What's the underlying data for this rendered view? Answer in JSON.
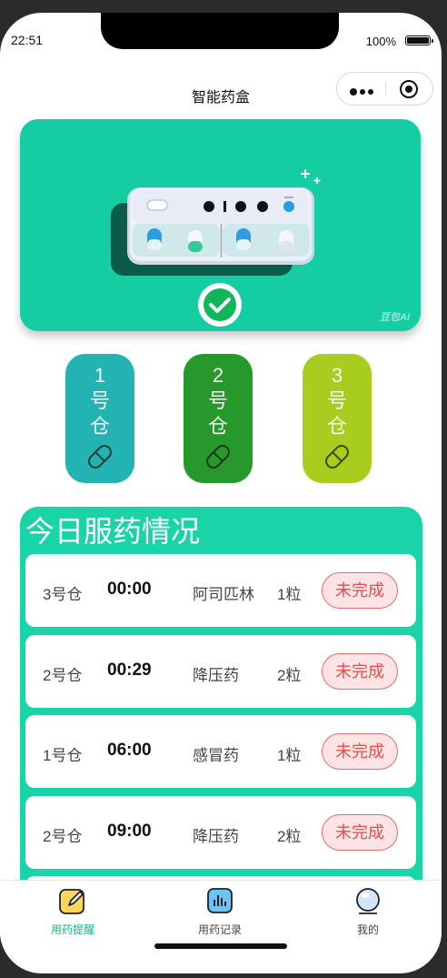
{
  "status_bar": {
    "time": "22:51",
    "battery": "100%"
  },
  "nav": {
    "title": "智能药盒"
  },
  "banner": {
    "watermark": "豆包AI"
  },
  "bins": [
    {
      "number": "1",
      "chars": [
        "号",
        "仓"
      ],
      "color": "#22b3b2"
    },
    {
      "number": "2",
      "chars": [
        "号",
        "仓"
      ],
      "color": "#27992c"
    },
    {
      "number": "3",
      "chars": [
        "号",
        "仓"
      ],
      "color": "#a9cd1f"
    }
  ],
  "today": {
    "title": "今日服药情况",
    "rows": [
      {
        "bin": "3号仓",
        "time": "00:00",
        "medicine": "阿司匹林",
        "dose": "1粒",
        "status": "未完成"
      },
      {
        "bin": "2号仓",
        "time": "00:29",
        "medicine": "降压药",
        "dose": "2粒",
        "status": "未完成"
      },
      {
        "bin": "1号仓",
        "time": "06:00",
        "medicine": "感冒药",
        "dose": "1粒",
        "status": "未完成"
      },
      {
        "bin": "2号仓",
        "time": "09:00",
        "medicine": "降压药",
        "dose": "2粒",
        "status": "未完成"
      }
    ]
  },
  "tabbar": {
    "tabs": [
      {
        "label": "用药提醒",
        "icon": "edit-icon",
        "active": true
      },
      {
        "label": "用药记录",
        "icon": "chart-icon",
        "active": false
      },
      {
        "label": "我的",
        "icon": "profile-icon",
        "active": false
      }
    ],
    "active_color": "#1db47e"
  }
}
